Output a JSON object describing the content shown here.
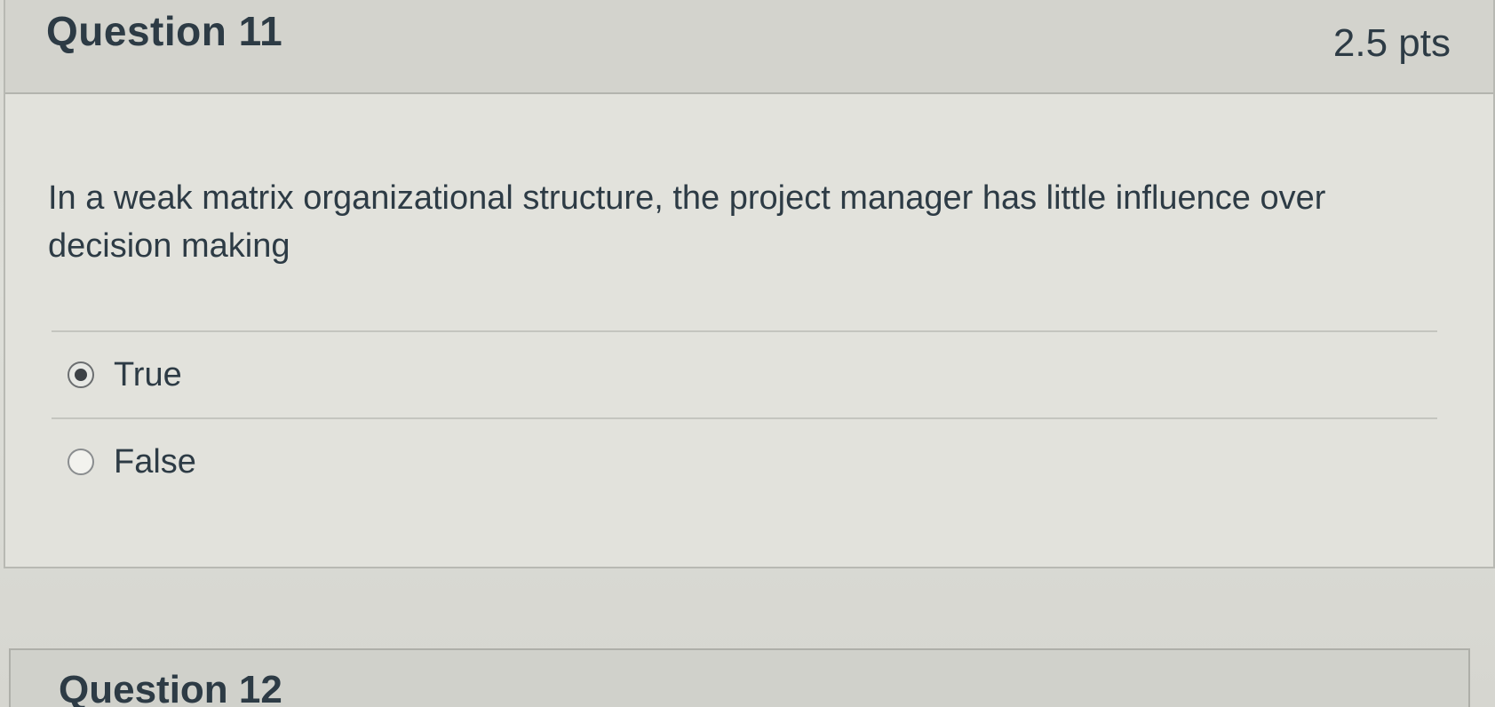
{
  "question11": {
    "title": "Question 11",
    "points": "2.5 pts",
    "text": "In a weak matrix organizational structure, the project manager has little influence over decision making",
    "answers": [
      {
        "label": "True",
        "selected": true
      },
      {
        "label": "False",
        "selected": false
      }
    ]
  },
  "question12": {
    "title": "Question 12"
  }
}
